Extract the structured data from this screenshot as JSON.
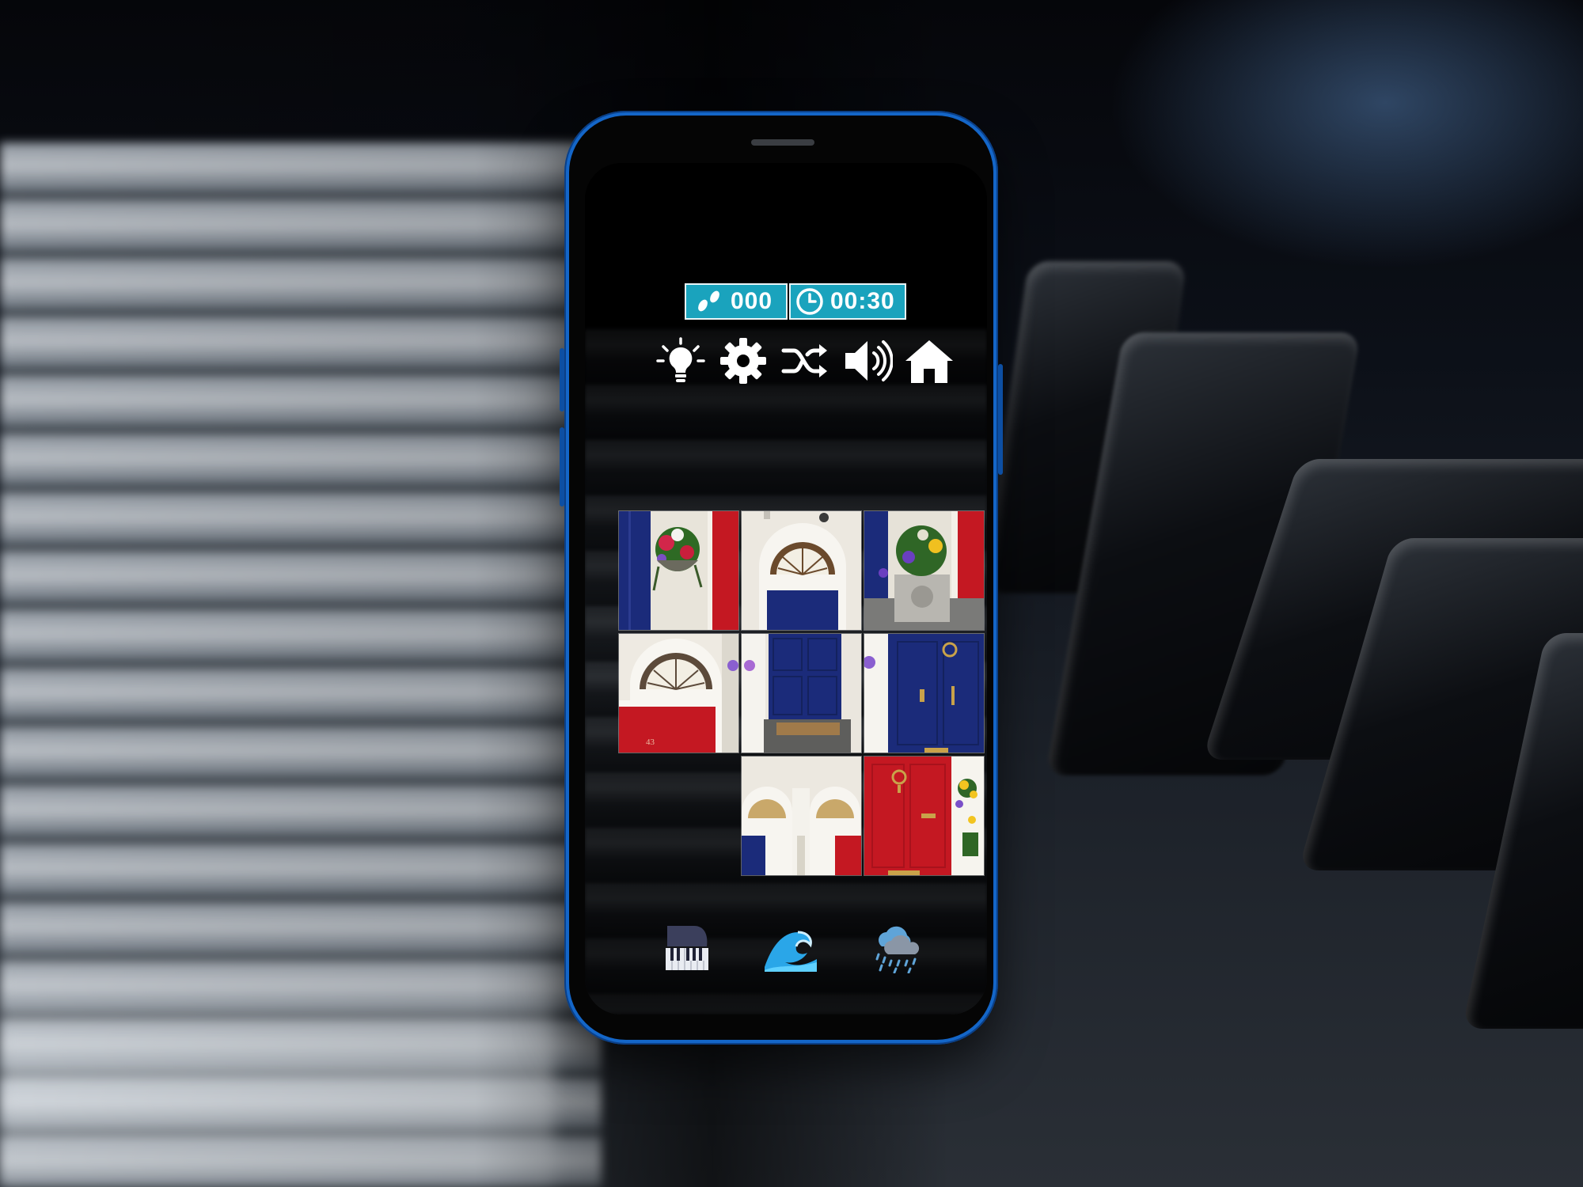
{
  "status": {
    "moves_icon": "footsteps-icon",
    "moves": "000",
    "timer_icon": "clock-icon",
    "time": "00:30"
  },
  "toolbar": [
    {
      "icon": "lightbulb-hint-icon"
    },
    {
      "icon": "gear-settings-icon"
    },
    {
      "icon": "shuffle-icon"
    },
    {
      "icon": "speaker-sound-icon"
    },
    {
      "icon": "home-icon"
    }
  ],
  "puzzle": {
    "grid": [
      3,
      3
    ],
    "tiles": [
      {
        "slot": 1,
        "image": "blue-door-flowers-red-door"
      },
      {
        "slot": 2,
        "image": "fanlight-blue-door-top"
      },
      {
        "slot": 3,
        "image": "planter-flowers-red-door"
      },
      {
        "slot": 4,
        "image": "fanlight-red-door-43"
      },
      {
        "slot": 5,
        "image": "blue-door-doormat"
      },
      {
        "slot": 6,
        "image": "blue-door-brass-handle"
      },
      {
        "slot": 7,
        "image": "empty"
      },
      {
        "slot": 8,
        "image": "fanlights-blue-red-doors"
      },
      {
        "slot": 9,
        "image": "red-door-yellow-flowers"
      }
    ],
    "door_number": "43"
  },
  "bottom_bar": [
    {
      "icon": "piano-music-icon"
    },
    {
      "icon": "wave-sound-icon"
    },
    {
      "icon": "rain-cloud-sound-icon"
    }
  ],
  "colors": {
    "counter_bg": "#1aa3bd",
    "phone_frame": "#1466c8",
    "door_blue": "#1b2b7a",
    "door_red": "#c41822"
  }
}
